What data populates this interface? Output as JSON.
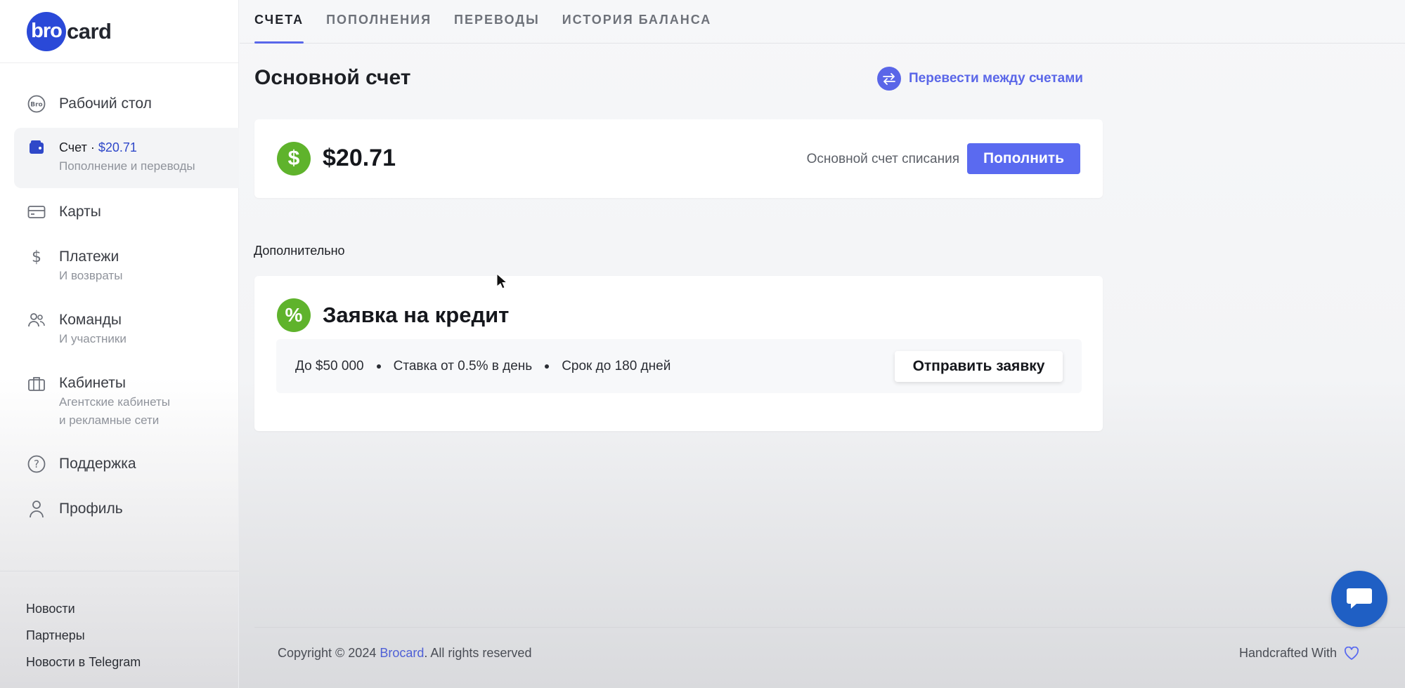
{
  "logo": {
    "circle_text": "bro",
    "rest_text": "card"
  },
  "sidebar": {
    "items": [
      {
        "label": "Рабочий стол",
        "sub": "",
        "icon": "bro-badge-icon"
      },
      {
        "label": "Счет · ",
        "amount": "$20.71",
        "sub": "Пополнение и переводы",
        "icon": "wallet-icon",
        "active": true
      },
      {
        "label": "Карты",
        "sub": "",
        "icon": "credit-card-icon"
      },
      {
        "label": "Платежи",
        "sub": "И возвраты",
        "icon": "dollar-icon"
      },
      {
        "label": "Команды",
        "sub": "И участники",
        "icon": "users-icon"
      },
      {
        "label": "Кабинеты",
        "sub": "Агентские кабинеты",
        "sub2": "и рекламные сети",
        "icon": "briefcase-icon"
      },
      {
        "label": "Поддержка",
        "sub": "",
        "icon": "help-circle-icon"
      },
      {
        "label": "Профиль",
        "sub": "",
        "icon": "user-icon"
      }
    ],
    "footer_links": [
      "Новости",
      "Партнеры",
      "Новости в Telegram"
    ]
  },
  "tabs": [
    {
      "label": "СЧЕТА",
      "active": true
    },
    {
      "label": "ПОПОЛНЕНИЯ"
    },
    {
      "label": "ПЕРЕВОДЫ"
    },
    {
      "label": "ИСТОРИЯ БАЛАНСА"
    }
  ],
  "main": {
    "title": "Основной счет",
    "transfer_link": "Перевести между счетами",
    "balance": {
      "amount": "$20.71",
      "description": "Основной счет списания",
      "topup_button": "Пополнить",
      "currency_symbol": "$"
    },
    "section_label": "Дополнительно",
    "credit": {
      "symbol": "%",
      "title": "Заявка на кредит",
      "terms": [
        "До $50 000",
        "Ставка от 0.5% в день",
        "Срок до 180 дней"
      ],
      "button": "Отправить заявку"
    }
  },
  "footer": {
    "copyright_prefix": "Copyright © 2024 ",
    "brand": "Brocard",
    "copyright_suffix": ". All rights reserved",
    "handcrafted": "Handcrafted With"
  },
  "colors": {
    "accent": "#5a6af0",
    "brand_blue": "#2a49d8",
    "green": "#5fb32c",
    "chat": "#1f5fc4"
  }
}
